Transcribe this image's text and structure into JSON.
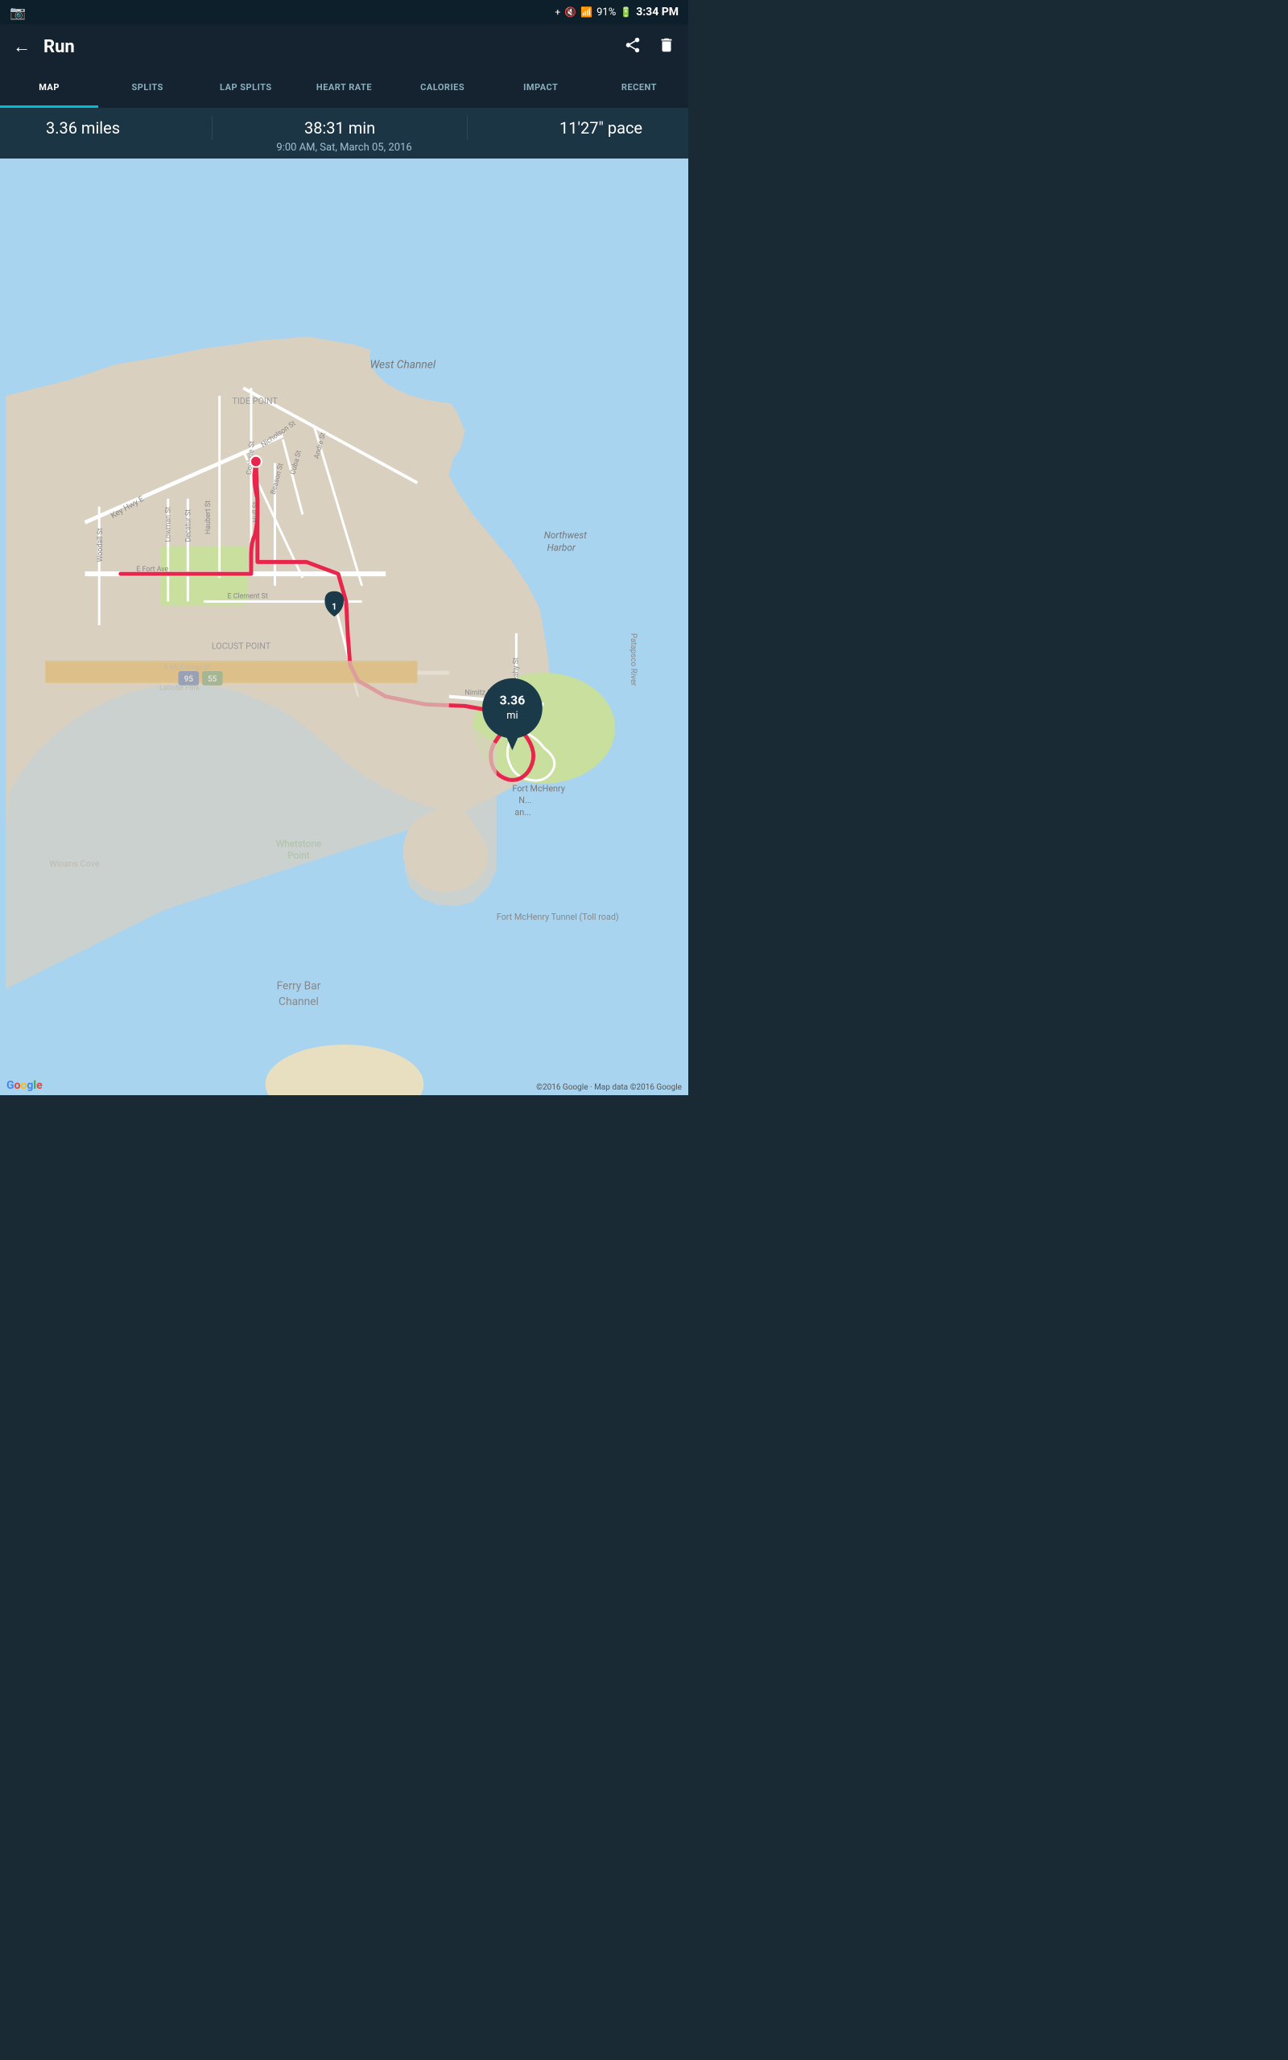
{
  "statusBar": {
    "time": "3:34 PM",
    "battery": "91%",
    "icons": [
      "bluetooth",
      "mute",
      "wifi",
      "battery"
    ]
  },
  "topBar": {
    "title": "Run",
    "backLabel": "←",
    "shareLabel": "share",
    "deleteLabel": "delete"
  },
  "tabs": [
    {
      "label": "MAP",
      "active": true
    },
    {
      "label": "SPLITS",
      "active": false
    },
    {
      "label": "LAP SPLITS",
      "active": false
    },
    {
      "label": "HEART RATE",
      "active": false
    },
    {
      "label": "CALORIES",
      "active": false
    },
    {
      "label": "IMPACT",
      "active": false
    },
    {
      "label": "RECENT",
      "active": false
    }
  ],
  "stats": {
    "distance": "3.36 miles",
    "duration": "38:31 min",
    "date": "9:00 AM, Sat, March 05, 2016",
    "pace": "11'27\" pace"
  },
  "map": {
    "endMarker": {
      "value": "3.36",
      "unit": "mi"
    },
    "midMarker": {
      "number": "1"
    },
    "copyright": "©2016 Google · Map data ©2016 Google",
    "googleLogo": "Google"
  }
}
